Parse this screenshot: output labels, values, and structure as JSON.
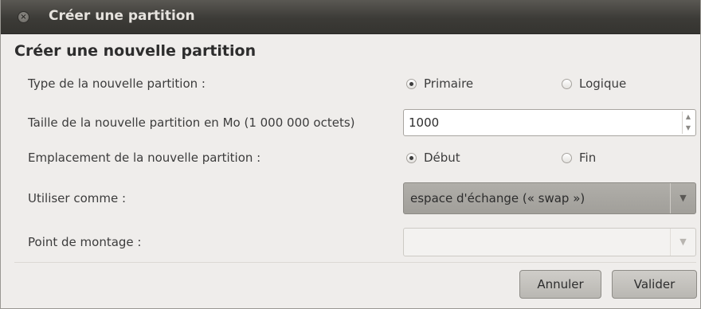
{
  "window": {
    "title": "Créer une partition",
    "close_icon": "close-icon"
  },
  "dialog": {
    "heading": "Créer une nouvelle partition",
    "type": {
      "label": "Type de la nouvelle partition :",
      "options": [
        "Primaire",
        "Logique"
      ],
      "selected": "Primaire"
    },
    "size": {
      "label": "Taille de la nouvelle partition en Mo (1 000 000 octets)",
      "value": "1000"
    },
    "location": {
      "label": "Emplacement de la nouvelle partition :",
      "options": [
        "Début",
        "Fin"
      ],
      "selected": "Début"
    },
    "use_as": {
      "label": "Utiliser comme :",
      "value": "espace d'échange (« swap »)"
    },
    "mount_point": {
      "label": "Point de montage :",
      "value": "",
      "enabled": false
    }
  },
  "buttons": {
    "cancel": "Annuler",
    "ok": "Valider"
  }
}
